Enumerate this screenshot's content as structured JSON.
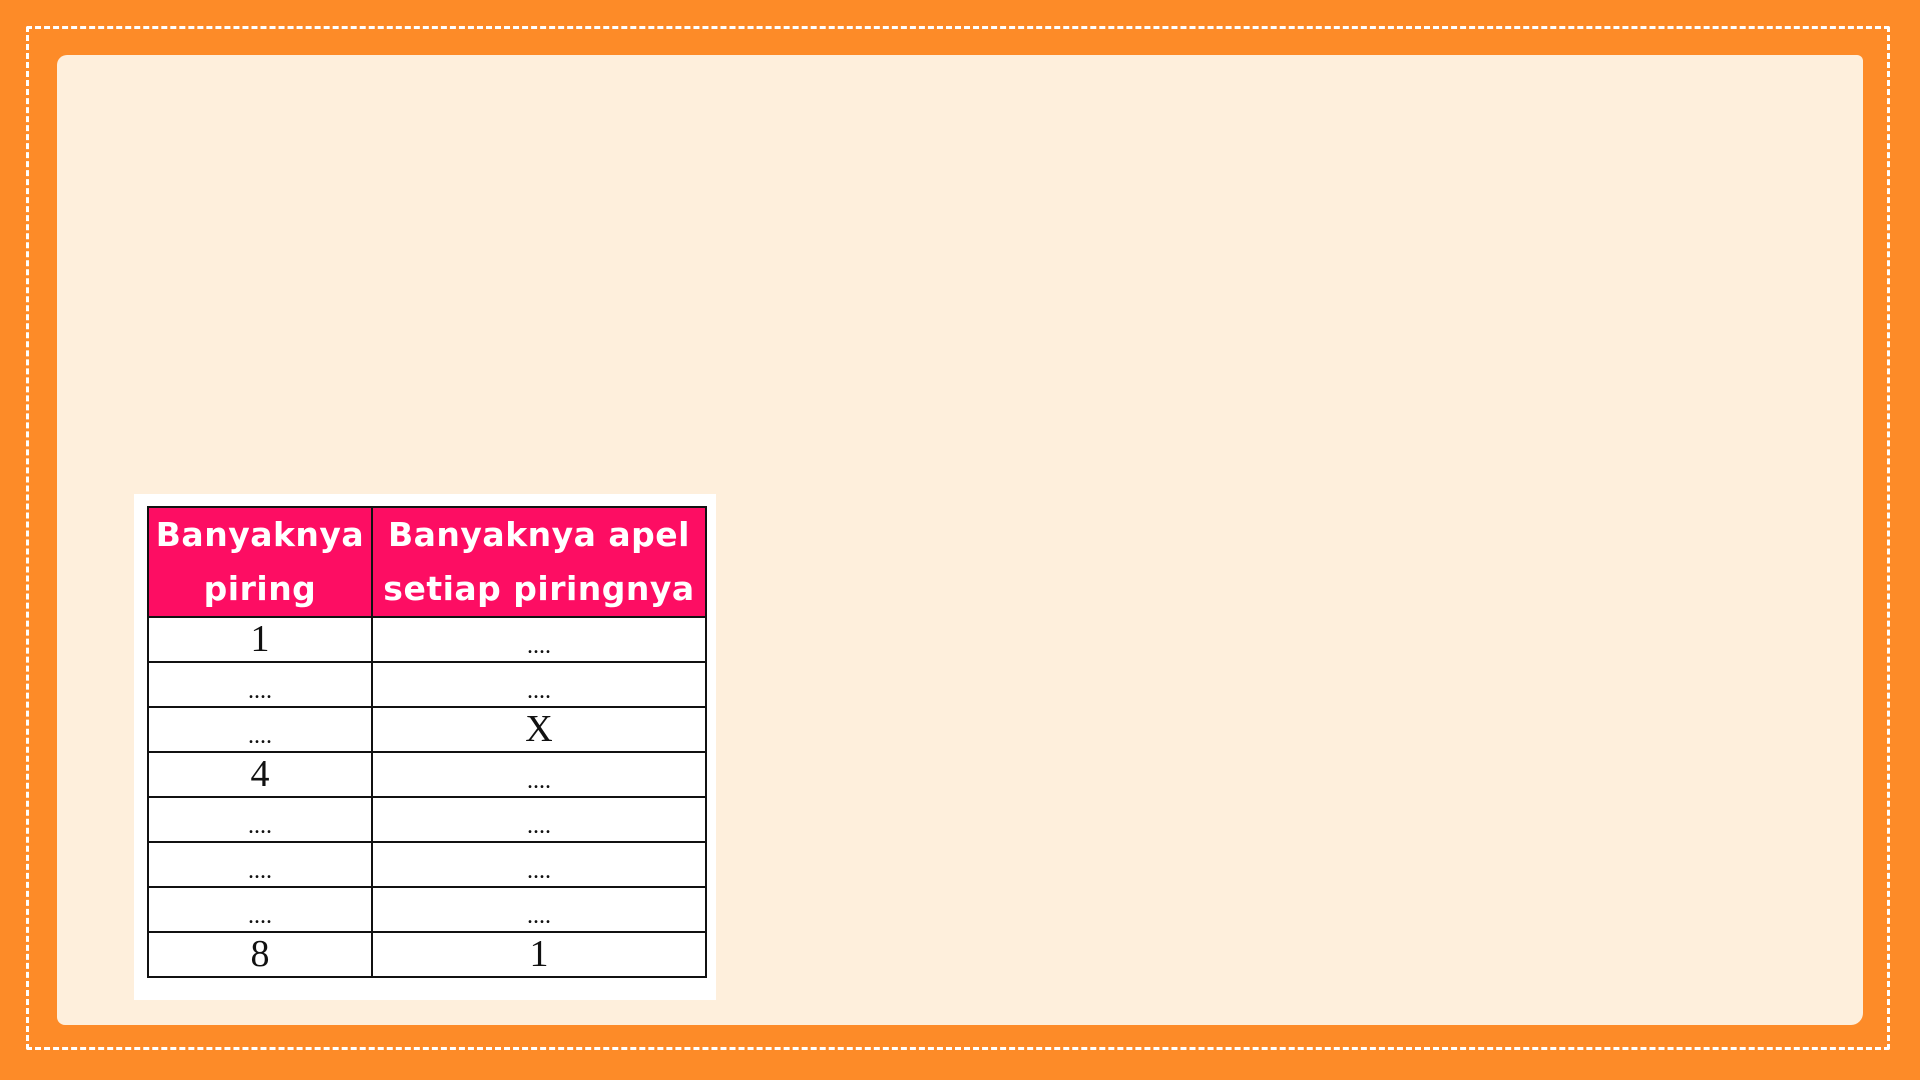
{
  "table": {
    "headers": [
      [
        "Banyaknya",
        "piring"
      ],
      [
        "Banyaknya apel",
        "setiap piringnya"
      ]
    ],
    "rows": [
      [
        "1",
        "...."
      ],
      [
        "....",
        "...."
      ],
      [
        "....",
        "X"
      ],
      [
        "4",
        "...."
      ],
      [
        "....",
        "...."
      ],
      [
        "....",
        "...."
      ],
      [
        "....",
        "...."
      ],
      [
        "8",
        "1"
      ]
    ]
  },
  "colors": {
    "background_orange": "#fd8b28",
    "paper": "#feefdc",
    "header_pink": "#fd0d63",
    "dash": "#ffffff"
  }
}
